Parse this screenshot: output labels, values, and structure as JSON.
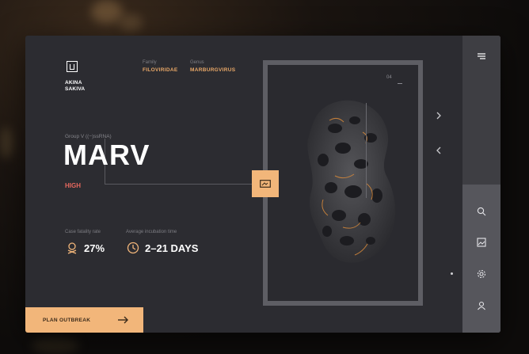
{
  "brand": {
    "name_line1": "AKINA",
    "name_line2": "SAKIVA"
  },
  "meta": {
    "family_label": "Family",
    "family_value": "FILOVIRIDAE",
    "genus_label": "Genus",
    "genus_value": "MARBURGVIRUS"
  },
  "virus": {
    "group": "Group V ((−)ssRNA)",
    "name": "MARV",
    "risk": "HIGH"
  },
  "stats": {
    "fatality_label": "Case fatality rate",
    "fatality_value": "27%",
    "incubation_label": "Average incubation time",
    "incubation_value": "2–21 DAYS"
  },
  "cta": {
    "label": "PLAN OUTBREAK"
  },
  "frame": {
    "number": "04"
  },
  "icons": {
    "menu": "menu-icon",
    "search": "search-icon",
    "image": "image-icon",
    "settings": "gear-icon",
    "user": "user-icon",
    "next": "chevron-right-icon",
    "prev": "chevron-left-icon",
    "media": "media-icon",
    "arrow": "arrow-right-icon"
  },
  "colors": {
    "accent": "#f2b67a",
    "risk": "#e6685e",
    "panel": "#2c2c31"
  }
}
